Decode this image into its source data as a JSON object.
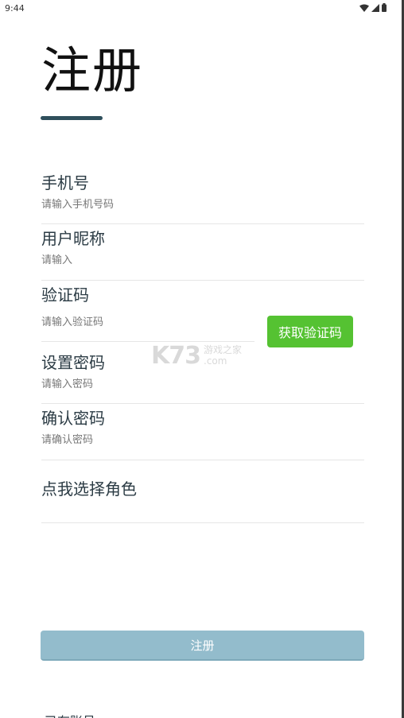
{
  "status_bar": {
    "time": "9:44",
    "icons": [
      "wifi-icon",
      "signal-icon",
      "battery-icon"
    ]
  },
  "page": {
    "title": "注册",
    "accent_color": "#2f4f5c"
  },
  "form": {
    "phone": {
      "label": "手机号",
      "placeholder": "请输入手机号码"
    },
    "nickname": {
      "label": "用户昵称",
      "placeholder": "请输入"
    },
    "code": {
      "label": "验证码",
      "placeholder": "请输入验证码",
      "button_label": "获取验证码",
      "button_color": "#55c232"
    },
    "password": {
      "label": "设置密码",
      "placeholder": "请输入密码"
    },
    "confirm_password": {
      "label": "确认密码",
      "placeholder": "请确认密码"
    },
    "role_picker_label": "点我选择角色"
  },
  "register_button": {
    "label": "注册",
    "color": "#93bccc"
  },
  "watermark": {
    "brand": "K73",
    "site_name": "游戏之家",
    "domain": ".com"
  },
  "bottom_link_partial": "已有账号"
}
